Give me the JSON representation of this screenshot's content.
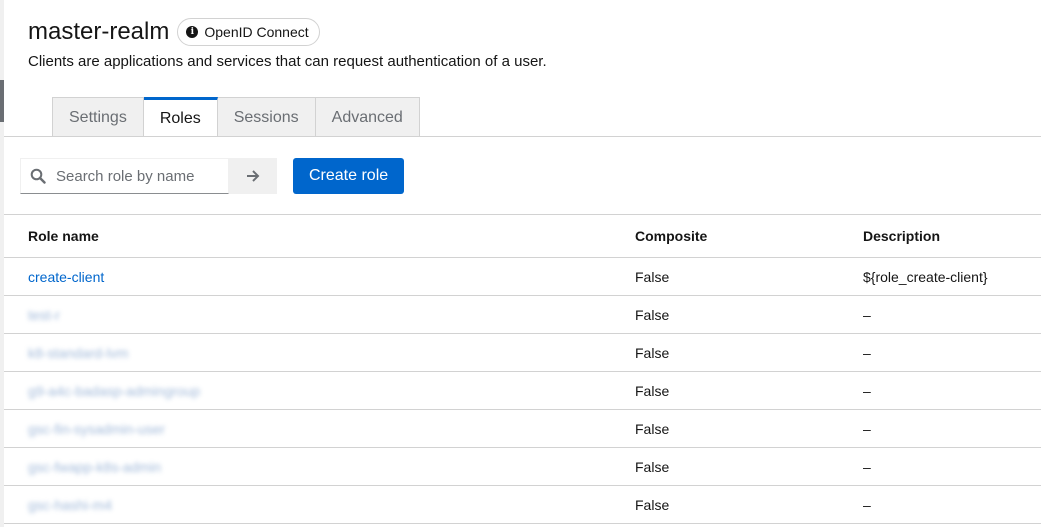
{
  "header": {
    "title": "master-realm",
    "protocol_badge": "OpenID Connect",
    "subtitle": "Clients are applications and services that can request authentication of a user."
  },
  "tabs": [
    {
      "label": "Settings",
      "active": false
    },
    {
      "label": "Roles",
      "active": true
    },
    {
      "label": "Sessions",
      "active": false
    },
    {
      "label": "Advanced",
      "active": false
    }
  ],
  "toolbar": {
    "search_placeholder": "Search role by name",
    "create_label": "Create role"
  },
  "table": {
    "headers": [
      "Role name",
      "Composite",
      "Description"
    ],
    "rows": [
      {
        "name": "create-client",
        "composite": "False",
        "description": "${role_create-client}",
        "blurred": false
      },
      {
        "name": "test-r",
        "composite": "False",
        "description": "–",
        "blurred": true
      },
      {
        "name": "k8-standard-lvm",
        "composite": "False",
        "description": "–",
        "blurred": true
      },
      {
        "name": "g9-a4c-badasp-admingroup",
        "composite": "False",
        "description": "–",
        "blurred": true
      },
      {
        "name": "gsc-fin-sysadmin-user",
        "composite": "False",
        "description": "–",
        "blurred": true
      },
      {
        "name": "gsc-fwapp-k8s-admin",
        "composite": "False",
        "description": "–",
        "blurred": true
      },
      {
        "name": "gsc-hashi-m4",
        "composite": "False",
        "description": "–",
        "blurred": true
      }
    ]
  },
  "colors": {
    "accent": "#0066cc",
    "border": "#d2d2d2",
    "tab_inactive_bg": "#f0f0f0"
  }
}
